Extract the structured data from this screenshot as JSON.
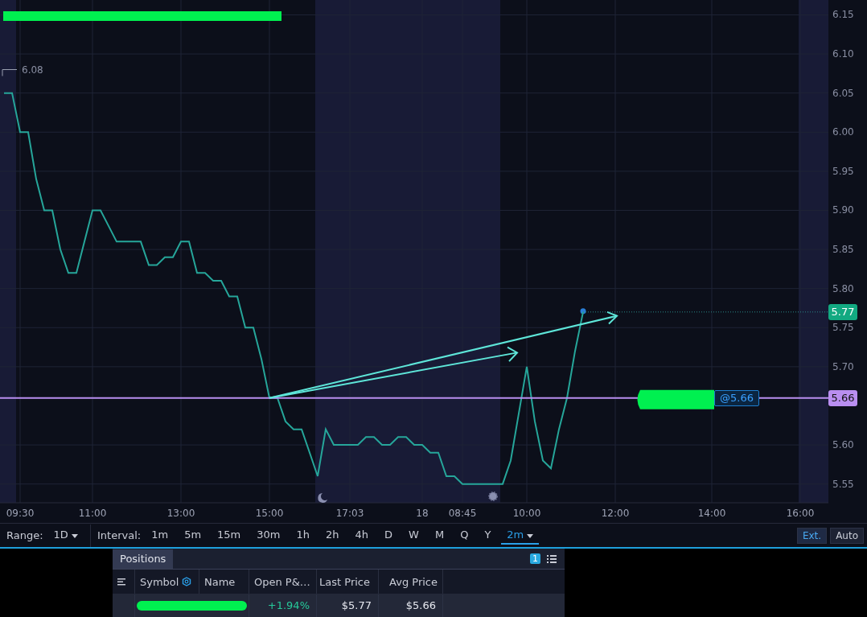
{
  "chart": {
    "high_marker": "6.08",
    "order_label": "@5.66",
    "last_price_label": "5.77",
    "position_price_label": "5.66",
    "chart_data": {
      "type": "line",
      "categories": [
        null,
        null,
        "09:30",
        null,
        null,
        null,
        null,
        null,
        null,
        null,
        null,
        "11:00",
        null,
        null,
        null,
        null,
        null,
        null,
        null,
        null,
        null,
        null,
        "13:00",
        null,
        null,
        null,
        null,
        null,
        null,
        null,
        null,
        null,
        null,
        "15:00",
        null,
        null,
        null,
        null,
        null,
        null,
        null,
        null,
        null,
        "17:03",
        null,
        null,
        null,
        null,
        null,
        null,
        null,
        null,
        "18",
        null,
        null,
        null,
        null,
        "08:45",
        null,
        null,
        null,
        null,
        null,
        null,
        null,
        "10:00",
        null,
        null,
        null,
        null,
        null,
        null,
        null,
        null,
        null,
        null,
        "12:00",
        null,
        null,
        null,
        null,
        null,
        null,
        null,
        null,
        null,
        null,
        null,
        "14:00",
        null,
        null,
        null,
        null,
        null,
        null,
        null,
        null,
        null,
        null,
        "16:00",
        null,
        null,
        null
      ],
      "series": [
        {
          "color": "#26a69a",
          "values": [
            6.05,
            6.05,
            6.0,
            6.0,
            5.94,
            5.9,
            5.9,
            5.85,
            5.82,
            5.82,
            5.86,
            5.9,
            5.9,
            5.88,
            5.86,
            5.86,
            5.86,
            5.86,
            5.83,
            5.83,
            5.84,
            5.84,
            5.86,
            5.86,
            5.82,
            5.82,
            5.81,
            5.81,
            5.79,
            5.79,
            5.75,
            5.75,
            5.71,
            5.66,
            5.66,
            5.63,
            5.62,
            5.62,
            5.59,
            5.56,
            5.62,
            5.6,
            5.6,
            5.6,
            5.6,
            5.61,
            5.61,
            5.6,
            5.6,
            5.61,
            5.61,
            5.6,
            5.6,
            5.59,
            5.59,
            5.56,
            5.56,
            5.55,
            5.55,
            5.55,
            5.55,
            5.55,
            5.55,
            5.58,
            5.64,
            5.7,
            5.63,
            5.58,
            5.57,
            5.62,
            5.66,
            5.72,
            5.77,
            null,
            null,
            null,
            null,
            null,
            null,
            null,
            null,
            null,
            null,
            null,
            null,
            null,
            null,
            null,
            null,
            null,
            null,
            null,
            null,
            null,
            null,
            null,
            null,
            null,
            null,
            null,
            null,
            null,
            null
          ]
        }
      ],
      "ylim": [
        5.526,
        6.169
      ],
      "grid": true,
      "yticks": [
        {
          "value": 5.55,
          "label": "5.55"
        },
        {
          "value": 5.6,
          "label": "5.60"
        },
        {
          "value": 5.7,
          "label": "5.70"
        },
        {
          "value": 5.75,
          "label": "5.75"
        },
        {
          "value": 5.8,
          "label": "5.80"
        },
        {
          "value": 5.85,
          "label": "5.85"
        },
        {
          "value": 5.9,
          "label": "5.90"
        },
        {
          "value": 5.95,
          "label": "5.95"
        },
        {
          "value": 6.0,
          "label": "6.00"
        },
        {
          "value": 6.05,
          "label": "6.05"
        },
        {
          "value": 6.1,
          "label": "6.10"
        },
        {
          "value": 6.15,
          "label": "6.15"
        }
      ]
    }
  },
  "toolbar": {
    "range_label": "Range:",
    "range_value": "1D",
    "interval_label": "Interval:",
    "intervals": [
      {
        "label": "1m",
        "selected": false
      },
      {
        "label": "5m",
        "selected": false
      },
      {
        "label": "15m",
        "selected": false
      },
      {
        "label": "30m",
        "selected": false
      },
      {
        "label": "1h",
        "selected": false
      },
      {
        "label": "2h",
        "selected": false
      },
      {
        "label": "4h",
        "selected": false
      },
      {
        "label": "D",
        "selected": false
      },
      {
        "label": "W",
        "selected": false
      },
      {
        "label": "M",
        "selected": false
      },
      {
        "label": "Q",
        "selected": false
      },
      {
        "label": "Y",
        "selected": false
      },
      {
        "label": "2m",
        "selected": true
      }
    ],
    "buttons": [
      {
        "label": "Ext.",
        "selected": true
      },
      {
        "label": "Auto",
        "selected": false
      }
    ]
  },
  "positions": {
    "tab": "Positions",
    "count": "1",
    "columns": [
      "Symbol",
      "Name",
      "Open P&…",
      "Last Price",
      "Avg Price"
    ],
    "rows": [
      {
        "open_pl": "+1.94%",
        "last_price": "$5.77",
        "avg_price": "$5.66"
      }
    ]
  }
}
